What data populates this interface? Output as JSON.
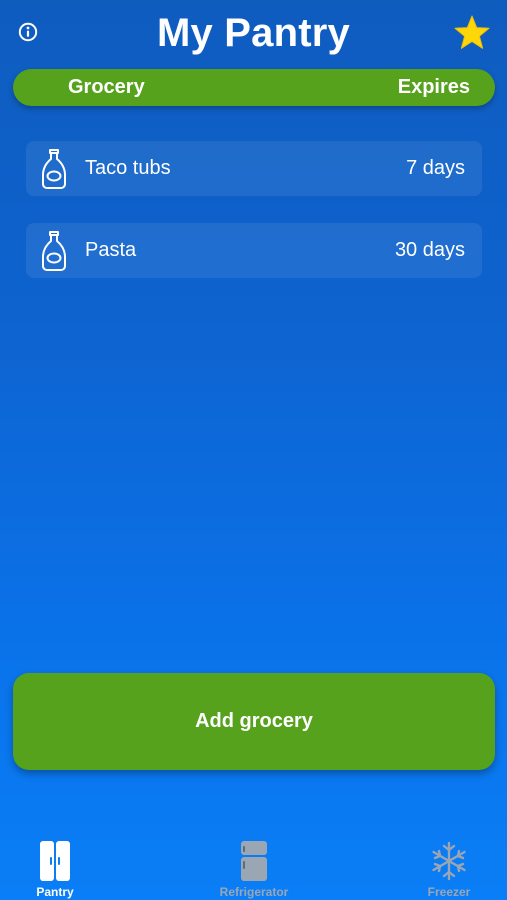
{
  "header": {
    "title": "My Pantry",
    "info_icon": "info-icon",
    "favorite_icon": "star-icon"
  },
  "columns": {
    "grocery": "Grocery",
    "expires": "Expires"
  },
  "items": [
    {
      "name": "Taco tubs",
      "expires": "7 days",
      "icon": "bottle-icon"
    },
    {
      "name": "Pasta",
      "expires": "30 days",
      "icon": "bottle-icon"
    }
  ],
  "actions": {
    "add_label": "Add grocery"
  },
  "tabs": [
    {
      "label": "Pantry",
      "icon": "pantry-icon",
      "active": true
    },
    {
      "label": "Refrigerator",
      "icon": "refrigerator-icon",
      "active": false
    },
    {
      "label": "Freezer",
      "icon": "snowflake-icon",
      "active": false
    }
  ],
  "colors": {
    "accent_green": "#56a21d",
    "background_top": "#0f5cbf",
    "background_bottom": "#0a7ef6",
    "star": "#ffd60a",
    "inactive_tab": "#9aa6b4"
  }
}
